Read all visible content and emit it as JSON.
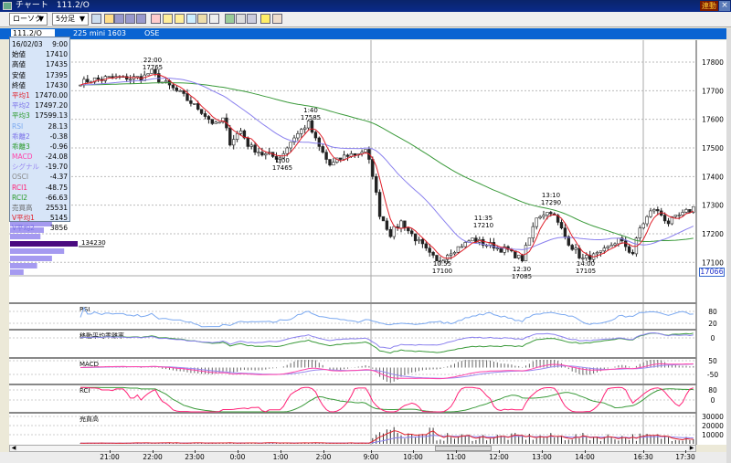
{
  "window": {
    "icon": "chart-icon",
    "title": "チャート　111.2/O",
    "sync_label": "連動",
    "close_label": "×"
  },
  "toolbar": {
    "chart_type": "ローソク",
    "interval": "5分足",
    "icons": [
      "tile-icon",
      "ma-icon",
      "bb-icon",
      "mei-icon",
      "pa-icon",
      "line-chart-icon",
      "bar-chart-icon",
      "point-figure-icon",
      "zoom-icon",
      "indicator-icon",
      "split-icon",
      "pen-icon",
      "cursor-icon",
      "eraser-icon",
      "search-icon",
      "settings-icon"
    ]
  },
  "header": {
    "symbol": "111.2/O",
    "instrument": "225 mini 1603",
    "exchange": "OSE"
  },
  "info": {
    "rows": [
      {
        "k": "16/02/03",
        "v": "9:00",
        "c": "#000000"
      },
      {
        "k": "始値",
        "v": "17410",
        "c": "#000000"
      },
      {
        "k": "高値",
        "v": "17435",
        "c": "#000000"
      },
      {
        "k": "安値",
        "v": "17395",
        "c": "#000000"
      },
      {
        "k": "終値",
        "v": "17430",
        "c": "#000000"
      },
      {
        "k": "平均1",
        "v": "17470.00",
        "c": "#e0202a"
      },
      {
        "k": "平均2",
        "v": "17497.20",
        "c": "#7a70e8"
      },
      {
        "k": "平均3",
        "v": "17599.13",
        "c": "#2a9a2a"
      },
      {
        "k": "RSI",
        "v": "28.13",
        "c": "#7aa8f0"
      },
      {
        "k": "乖離2",
        "v": "-0.38",
        "c": "#7a70e8"
      },
      {
        "k": "乖離3",
        "v": "-0.96",
        "c": "#2a9a2a"
      },
      {
        "k": "MACD",
        "v": "-24.08",
        "c": "#ff44aa"
      },
      {
        "k": "シグナル",
        "v": "-19.70",
        "c": "#9a8af0"
      },
      {
        "k": "OSCI",
        "v": "-4.37",
        "c": "#888888"
      },
      {
        "k": "RCI1",
        "v": "-48.75",
        "c": "#ff2277"
      },
      {
        "k": "RCI2",
        "v": "-66.63",
        "c": "#2a9a2a"
      },
      {
        "k": "売買高",
        "v": "25531",
        "c": "#666666"
      },
      {
        "k": "V平均1",
        "v": "5145",
        "c": "#e0202a"
      },
      {
        "k": "V平均2",
        "v": "3856",
        "c": "#7a70e8"
      }
    ]
  },
  "volume_profile": {
    "max_label": "134230",
    "levels": [
      0.62,
      0.5,
      0.45,
      1.0,
      0.8,
      0.62,
      0.4,
      0.2
    ]
  },
  "chart_data": {
    "type": "candlestick",
    "price_axis": [
      17800,
      17700,
      17600,
      17500,
      17400,
      17300,
      17200,
      17100
    ],
    "last_price": "17066",
    "price_path": [
      [
        0,
        17730
      ],
      [
        8,
        17745
      ],
      [
        17,
        17745
      ],
      [
        20,
        17765
      ],
      [
        22,
        17740
      ],
      [
        27,
        17700
      ],
      [
        33,
        17640
      ],
      [
        38,
        17580
      ],
      [
        40,
        17600
      ],
      [
        42,
        17520
      ],
      [
        45,
        17560
      ],
      [
        47,
        17510
      ],
      [
        51,
        17480
      ],
      [
        56,
        17465
      ],
      [
        60,
        17540
      ],
      [
        64,
        17585
      ],
      [
        67,
        17500
      ],
      [
        70,
        17440
      ],
      [
        74,
        17470
      ],
      [
        80,
        17490
      ],
      [
        82,
        17410
      ],
      [
        84,
        17270
      ],
      [
        87,
        17200
      ],
      [
        90,
        17240
      ],
      [
        95,
        17170
      ],
      [
        100,
        17100
      ],
      [
        103,
        17130
      ],
      [
        110,
        17180
      ],
      [
        115,
        17160
      ],
      [
        120,
        17140
      ],
      [
        124,
        17110
      ],
      [
        128,
        17260
      ],
      [
        132,
        17280
      ],
      [
        137,
        17170
      ],
      [
        141,
        17110
      ],
      [
        146,
        17130
      ],
      [
        151,
        17180
      ],
      [
        155,
        17130
      ],
      [
        157,
        17220
      ],
      [
        161,
        17290
      ],
      [
        165,
        17240
      ],
      [
        172,
        17290
      ]
    ],
    "annotations": [
      {
        "time": "22:00",
        "price": "17765"
      },
      {
        "time": "1:40",
        "price": "17585"
      },
      {
        "time": "1:00",
        "price": "17465"
      },
      {
        "time": "10:55",
        "price": "17100"
      },
      {
        "time": "11:35",
        "price": "17210"
      },
      {
        "time": "12:30",
        "price": "17085"
      },
      {
        "time": "13:10",
        "price": "17290"
      },
      {
        "time": "14:00",
        "price": "17105"
      }
    ],
    "ma_colors": {
      "ma1": "#e0202a",
      "ma2": "#8a80ee",
      "ma3": "#3a9a3a"
    },
    "time_labels": [
      "21:00",
      "22:00",
      "23:00",
      "0:00",
      "1:00",
      "2:00",
      "9:00",
      "10:00",
      "11:00",
      "12:00",
      "13:00",
      "14:00",
      "16:30",
      "17:30"
    ],
    "panels": [
      {
        "title": "RSI",
        "ticks": [
          "80",
          "20"
        ]
      },
      {
        "title": "移動平均乖離率",
        "ticks": [
          "0"
        ]
      },
      {
        "title": "MACD",
        "ticks": [
          "50",
          "-50"
        ]
      },
      {
        "title": "RCI",
        "ticks": [
          "80",
          "0"
        ]
      },
      {
        "title": "売買高",
        "ticks": [
          "30000",
          "20000",
          "10000"
        ]
      }
    ]
  }
}
